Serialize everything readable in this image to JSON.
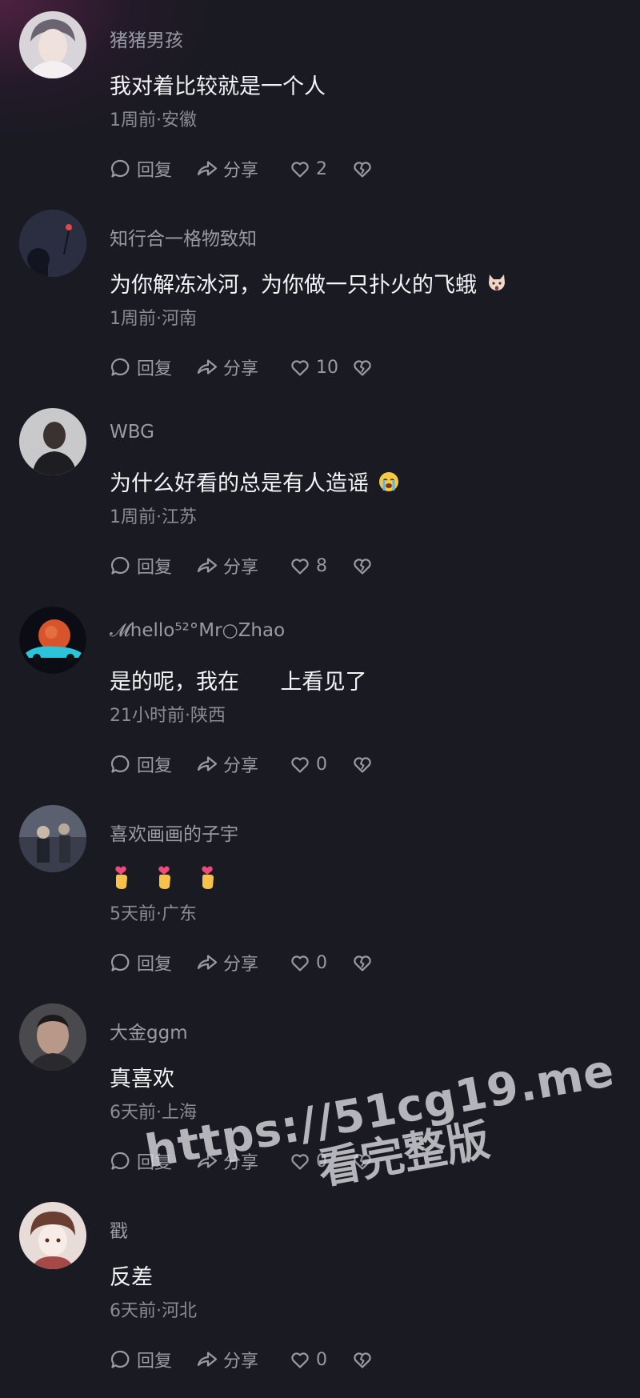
{
  "comments": [
    {
      "username": "猪猪男孩",
      "text": "我对着比较就是一个人",
      "time": "1周前",
      "location": "安徽",
      "meta": "1周前·安徽",
      "likes": "2"
    },
    {
      "username": "知行合一格物致知",
      "text": "为你解冻冰河，为你做一只扑火的飞蛾",
      "time": "1周前",
      "location": "河南",
      "meta": "1周前·河南",
      "likes": "10"
    },
    {
      "username": "WBG",
      "text": "为什么好看的总是有人造谣",
      "time": "1周前",
      "location": "江苏",
      "meta": "1周前·江苏",
      "likes": "8"
    },
    {
      "username": "𝓜hello⁵²°Mr○Zhao",
      "text": "是的呢，我在      上看见了",
      "time": "21小时前",
      "location": "陕西",
      "meta": "21小时前·陕西",
      "likes": "0"
    },
    {
      "username": "喜欢画画的子宇",
      "text": "",
      "time": "5天前",
      "location": "广东",
      "meta": "5天前·广东",
      "likes": "0"
    },
    {
      "username": "大金ggm",
      "text": "真喜欢",
      "time": "6天前",
      "location": "上海",
      "meta": "6天前·上海",
      "likes": "0"
    },
    {
      "username": "戳",
      "text": "反差",
      "time": "6天前",
      "location": "河北",
      "meta": "6天前·河北",
      "likes": "0"
    }
  ],
  "actions": {
    "reply_label": "回复",
    "share_label": "分享"
  },
  "icons": {
    "reply": "comment-bubble-icon",
    "share": "share-arrow-icon",
    "like": "heart-outline-icon",
    "dislike": "broken-heart-icon",
    "emoji_2": "shocked-cat-emoji",
    "emoji_3": "crying-face-emoji",
    "emoji_5": "finger-heart-emoji"
  },
  "watermark": {
    "url": "https://51cg19.me",
    "subtitle": "看完整版"
  },
  "colors": {
    "background": "#1a1a22",
    "username": "#9a9aa4",
    "text": "#f4f4f6",
    "meta": "#8c8c96"
  }
}
